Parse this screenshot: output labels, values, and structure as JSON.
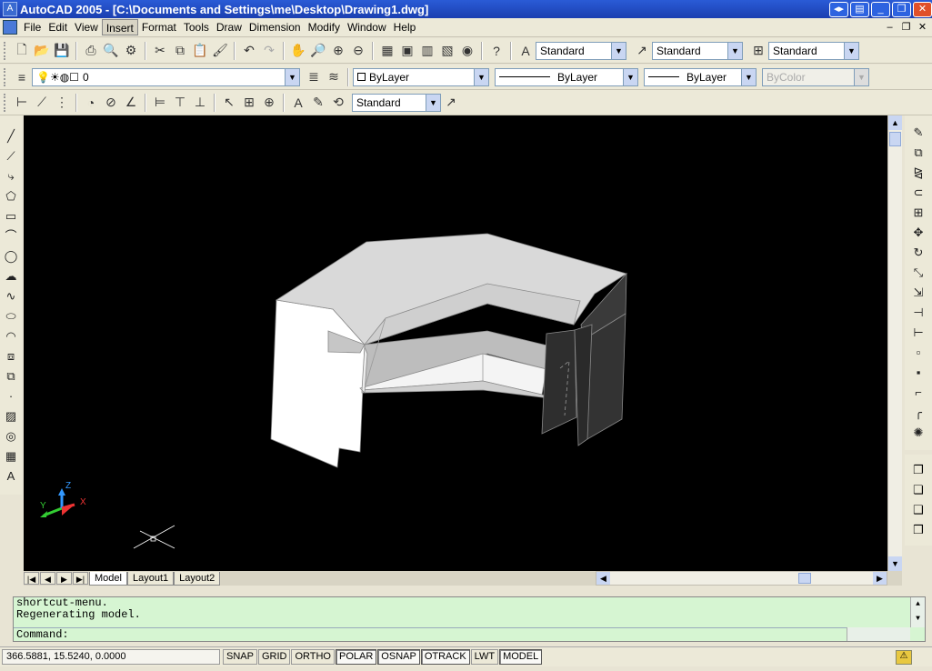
{
  "window": {
    "title": "AutoCAD 2005 - [C:\\Documents and Settings\\me\\Desktop\\Drawing1.dwg]"
  },
  "menu": [
    "File",
    "Edit",
    "View",
    "Insert",
    "Format",
    "Tools",
    "Draw",
    "Dimension",
    "Modify",
    "Window",
    "Help"
  ],
  "styles": {
    "text_style": "Standard",
    "dim_style": "Standard",
    "table_style": "Standard"
  },
  "layers": {
    "current_layer": "0",
    "color": "ByLayer",
    "linetype": "ByLayer",
    "lineweight": "ByLayer",
    "plotstyle": "ByColor"
  },
  "dim_toolbar": {
    "dim_style": "Standard"
  },
  "tabs": [
    "Model",
    "Layout1",
    "Layout2"
  ],
  "ucs": {
    "x": "X",
    "y": "Y",
    "z": "Z"
  },
  "command": {
    "history": [
      "shortcut-menu.",
      "Regenerating model."
    ],
    "prompt": "Command:"
  },
  "status": {
    "coords": "366.5881, 15.5240, 0.0000",
    "toggles": [
      {
        "label": "SNAP",
        "on": false
      },
      {
        "label": "GRID",
        "on": false
      },
      {
        "label": "ORTHO",
        "on": false
      },
      {
        "label": "POLAR",
        "on": true
      },
      {
        "label": "OSNAP",
        "on": true
      },
      {
        "label": "OTRACK",
        "on": true
      },
      {
        "label": "LWT",
        "on": false
      },
      {
        "label": "MODEL",
        "on": true
      }
    ]
  }
}
